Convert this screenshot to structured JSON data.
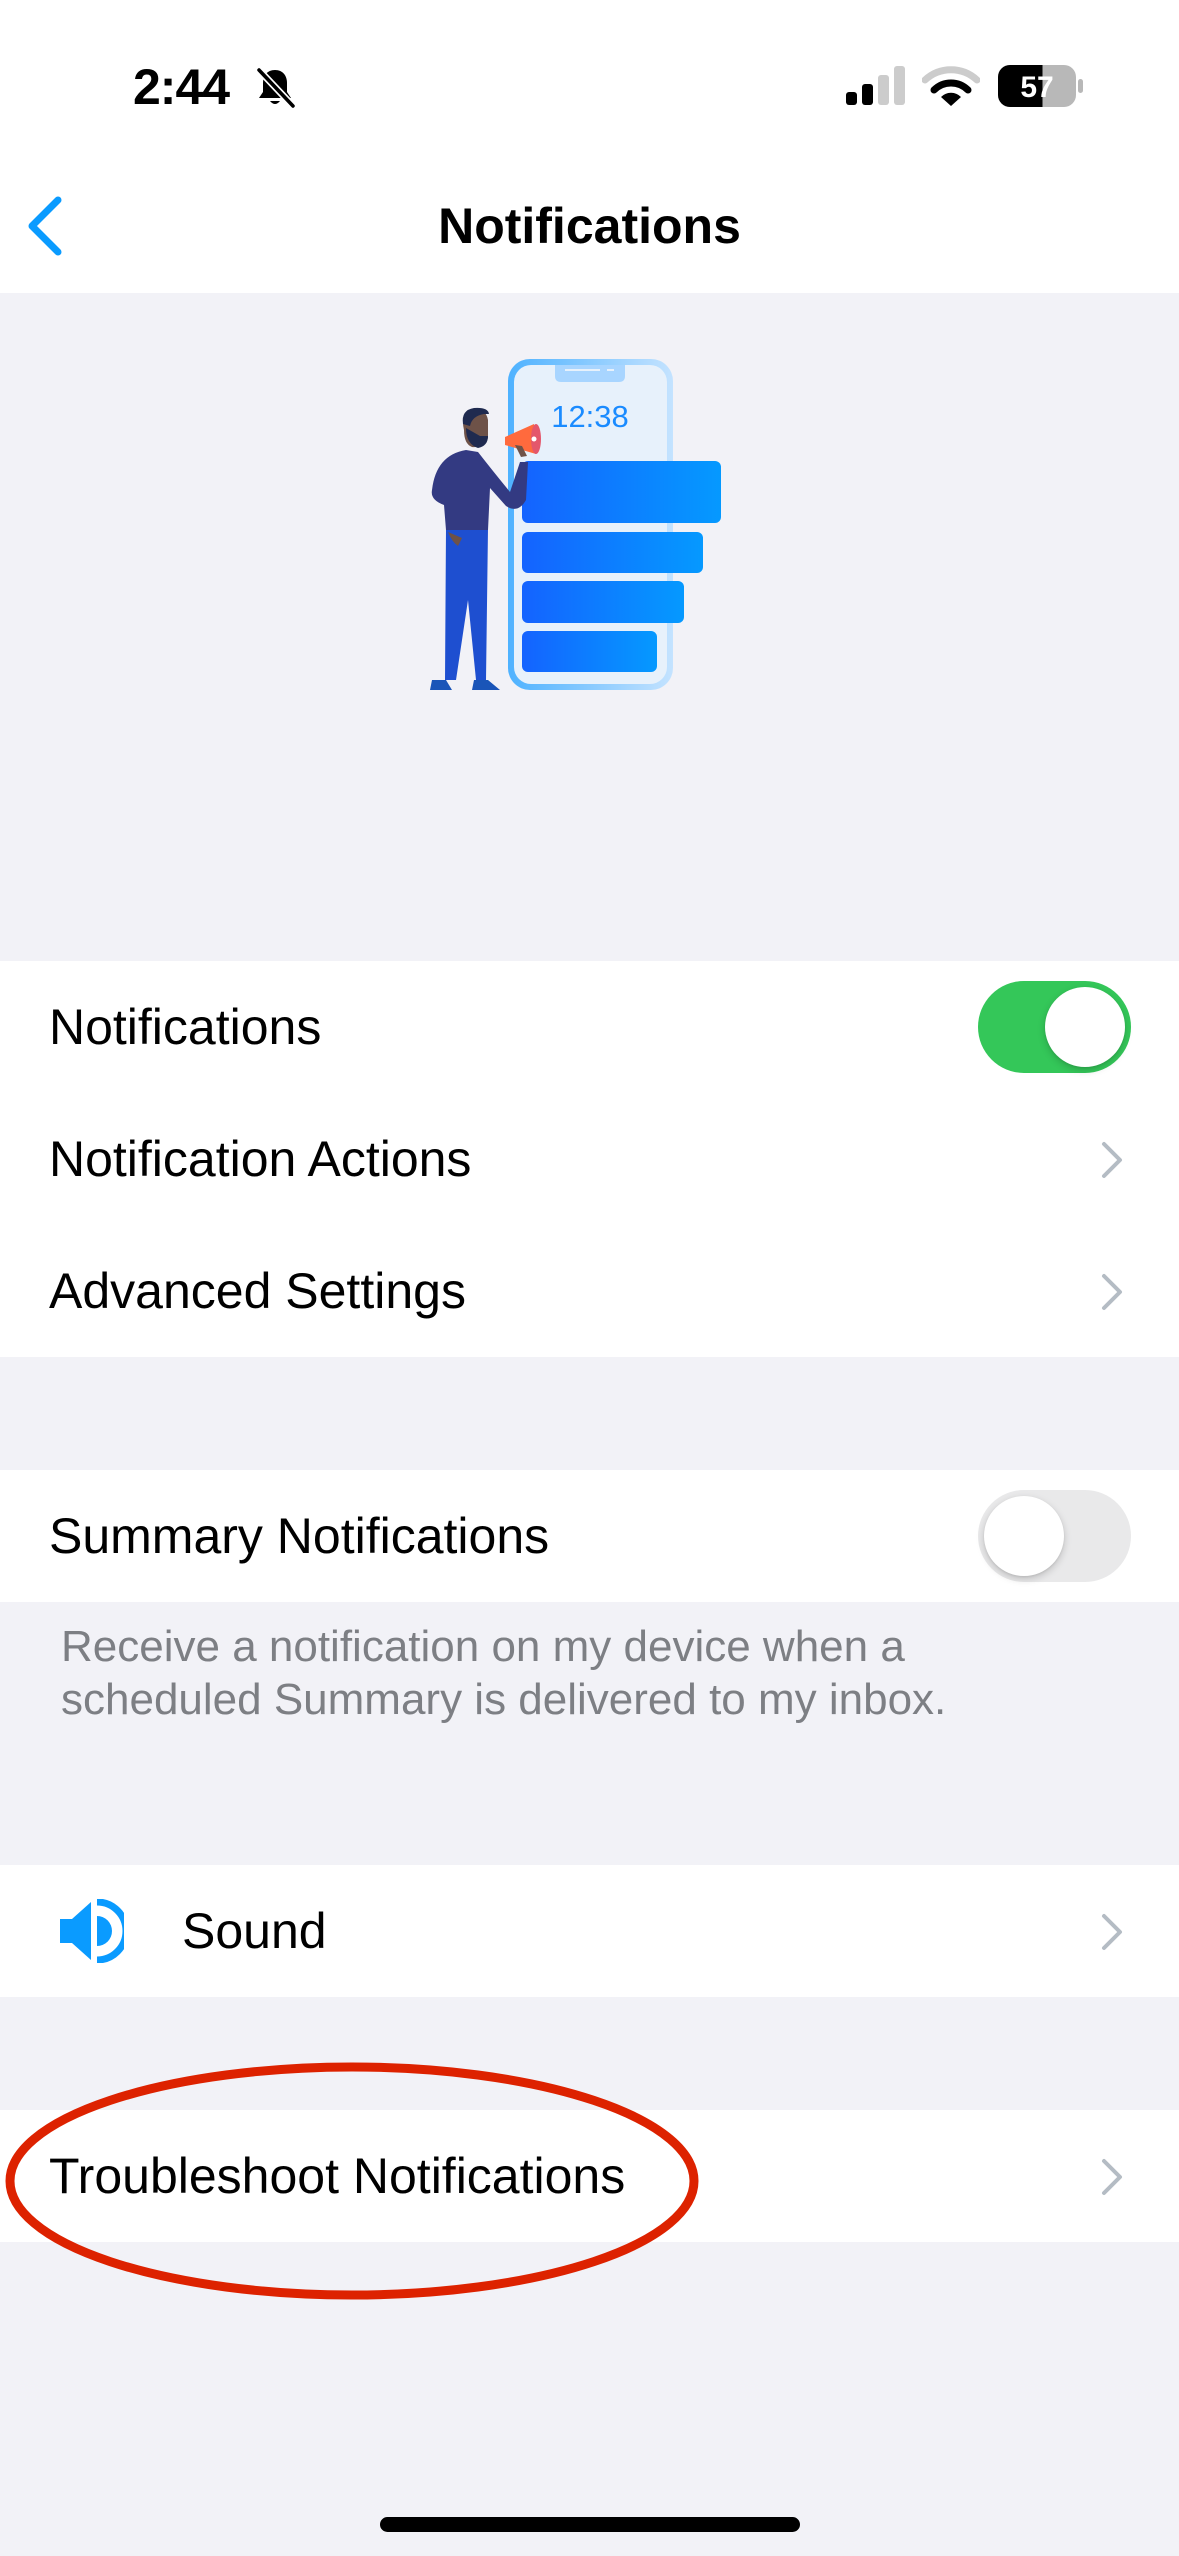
{
  "status_bar": {
    "time": "2:44",
    "silent_icon": "bell-slash-icon",
    "signal_icon": "cellular-signal-icon",
    "wifi_icon": "wifi-icon",
    "battery_percent": "57",
    "battery_level": 0.57
  },
  "nav": {
    "back_icon": "chevron-left-icon",
    "title": "Notifications"
  },
  "illustration": {
    "phone_clock": "12:38",
    "description": "person-with-megaphone-and-phone-notifications"
  },
  "sections": [
    {
      "rows": [
        {
          "label": "Notifications",
          "control": "toggle",
          "value": true
        },
        {
          "label": "Notification Actions",
          "control": "chevron"
        },
        {
          "label": "Advanced Settings",
          "control": "chevron"
        }
      ]
    },
    {
      "rows": [
        {
          "label": "Summary Notifications",
          "control": "toggle",
          "value": false
        }
      ],
      "footer": "Receive a notification on my device when a scheduled Summary is delivered to my inbox."
    },
    {
      "rows": [
        {
          "label": "Sound",
          "icon": "speaker-icon",
          "control": "chevron"
        }
      ]
    },
    {
      "rows": [
        {
          "label": "Troubleshoot Notifications",
          "control": "chevron",
          "highlighted": true
        }
      ]
    }
  ],
  "colors": {
    "accent": "#0A9BFF",
    "toggle_on": "#34C759",
    "toggle_off": "#E9E9EA",
    "background": "#F2F2F7",
    "annotation": "#DD2200",
    "chevron": "#B4BCC4",
    "footer_text": "#7D7F84"
  }
}
